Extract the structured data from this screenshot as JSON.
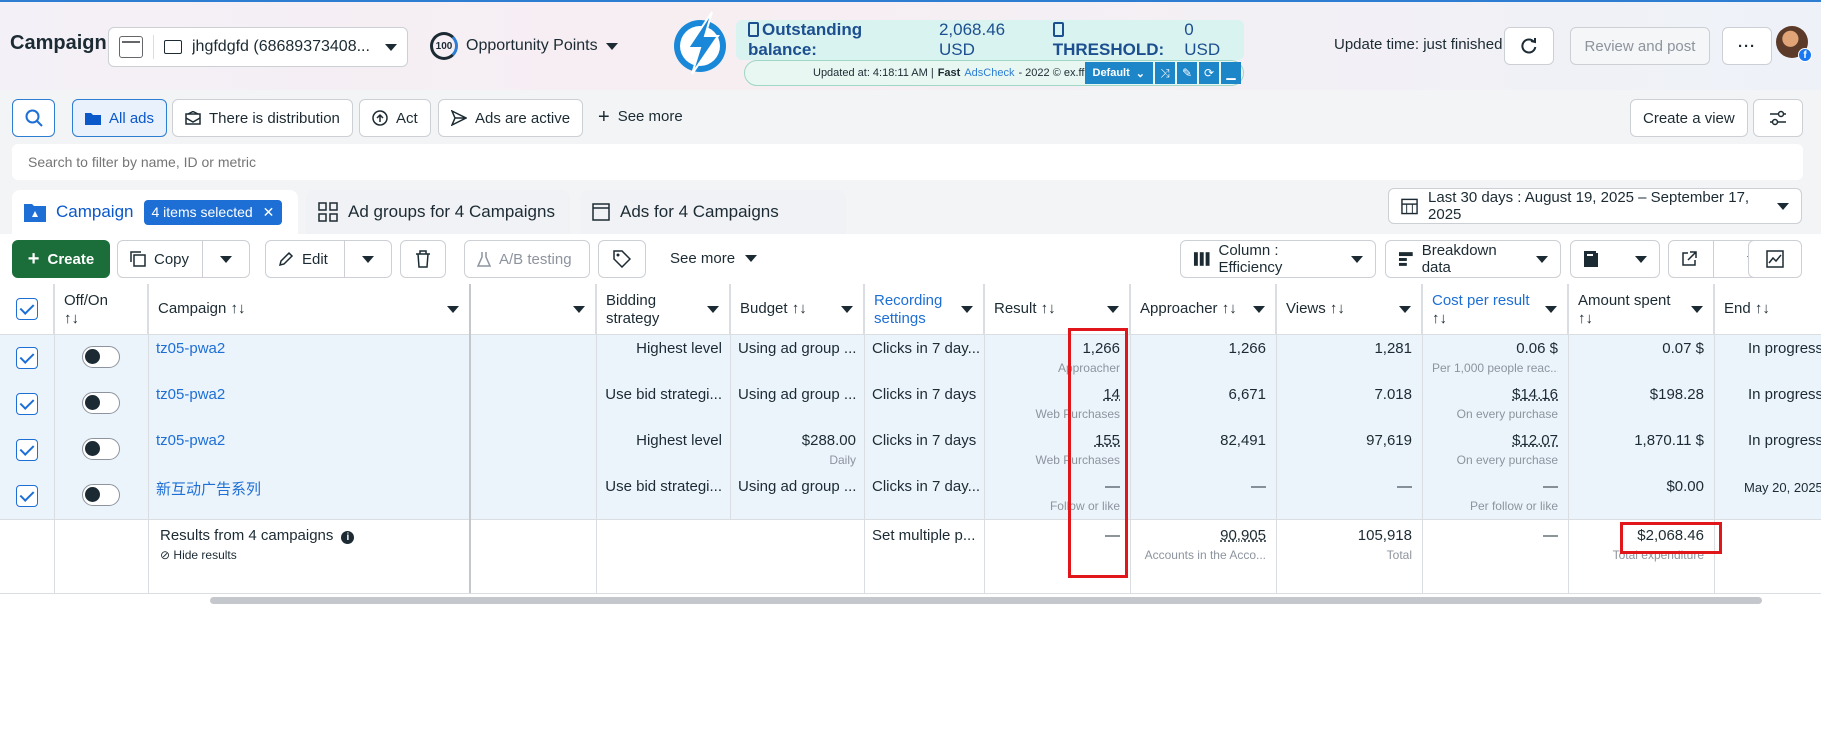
{
  "header": {
    "title": "Campaign",
    "account": "jhgfdgfd (68689373408...",
    "opportunity": {
      "score": "100",
      "label": "Opportunity Points"
    },
    "balance": {
      "label": "Outstanding balance:",
      "value": "2,068.46 USD",
      "threshold_label": "THRESHOLD:",
      "threshold_value": "0 USD"
    },
    "strip": {
      "updated": "Updated at: 4:18:11 AM |",
      "fast": "Fast",
      "adscheck": "AdsCheck",
      "tail": "- 2022 © ex.ffb.vn",
      "default_label": "Default"
    },
    "update_time": "Update time: just finished",
    "review_label": "Review and post",
    "more_label": "···",
    "icons": {
      "refresh": "refresh-icon",
      "bolt": "lightning-bolt-logo"
    }
  },
  "filters": {
    "all_ads": "All ads",
    "distribution": "There is distribution",
    "act": "Act",
    "ads_active": "Ads are active",
    "see_more": "See more",
    "create_view": "Create a view",
    "search_placeholder": "Search to filter by name, ID or metric"
  },
  "tabs": {
    "campaign": "Campaign",
    "selected": "4 items selected",
    "ad_groups": "Ad groups for 4 Campaigns",
    "ads": "Ads for 4 Campaigns",
    "date_range": "Last 30 days : August 19, 2025 – September 17, 2025"
  },
  "toolbar": {
    "create": "Create",
    "copy": "Copy",
    "edit": "Edit",
    "ab_testing": "A/B testing",
    "see_more": "See more",
    "columns": "Column : Efficiency",
    "breakdown": "Breakdown data"
  },
  "table": {
    "headers": {
      "off_on": "Off/On",
      "off_on_sort": "↑↓",
      "campaign": "Campaign ↑↓",
      "bidding": "Bidding",
      "bidding2": "strategy",
      "budget": "Budget ↑↓",
      "recording": "Recording",
      "recording2": "settings",
      "result": "Result ↑↓",
      "approacher": "Approacher ↑↓",
      "views": "Views ↑↓",
      "cpr": "Cost per result",
      "cpr2": "↑↓",
      "spent": "Amount spent",
      "spent2": "↑↓",
      "end": "End ↑↓"
    },
    "rows": [
      {
        "name": "tz05-pwa2",
        "bidding": "Highest level",
        "budget": "Using ad group ...",
        "budget_sub": "",
        "recording": "Clicks in 7 day...",
        "result": "1,266",
        "result_sub": "Approacher",
        "approacher": "1,266",
        "views": "1,281",
        "cpr": "0.06 $",
        "cpr_sub": "Per 1,000 people reac...",
        "spent": "0.07 $",
        "end": "In progress"
      },
      {
        "name": "tz05-pwa2",
        "bidding": "Use bid strategi...",
        "budget": "Using ad group ...",
        "budget_sub": "",
        "recording": "Clicks in 7 days",
        "result": "14",
        "result_sub": "Web Purchases",
        "approacher": "6,671",
        "views": "7.018",
        "cpr": "$14.16",
        "cpr_sub": "On every purchase",
        "spent": "$198.28",
        "end": "In progress"
      },
      {
        "name": "tz05-pwa2",
        "bidding": "Highest level",
        "budget": "$288.00",
        "budget_sub": "Daily",
        "recording": "Clicks in 7 days",
        "result": "155",
        "result_sub": "Web Purchases",
        "approacher": "82,491",
        "views": "97,619",
        "cpr": "$12.07",
        "cpr_sub": "On every purchase",
        "spent": "1,870.11 $",
        "end": "In progress"
      },
      {
        "name": "新互动广告系列",
        "bidding": "Use bid strategi...",
        "budget": "Using ad group ...",
        "budget_sub": "",
        "recording": "Clicks in 7 day...",
        "result": "—",
        "result_sub": "Follow or like",
        "approacher": "—",
        "views": "—",
        "cpr": "—",
        "cpr_sub": "Per follow or like",
        "spent": "$0.00",
        "end": "May 20, 2025"
      }
    ],
    "summary": {
      "label": "Results from 4 campaigns",
      "hide": "Hide results",
      "recording": "Set multiple p...",
      "result": "—",
      "approacher": "90,905",
      "approacher_sub": "Accounts in the Acco...",
      "views": "105,918",
      "views_sub": "Total",
      "cpr": "—",
      "spent": "$2,068.46",
      "spent_sub": "Total expenditure"
    }
  },
  "colors": {
    "accent": "#1d6fd6",
    "create_green": "#1b6e3a",
    "highlight_red": "#e0161b"
  }
}
